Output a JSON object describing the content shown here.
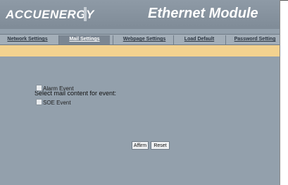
{
  "header": {
    "logo_text": "ACCUENERGY",
    "title": "Ethernet Module"
  },
  "nav": {
    "items": [
      {
        "label": "Network Settings",
        "active": false
      },
      {
        "label": "Mail Settings",
        "active": true
      },
      {
        "label": "Webpage Settings",
        "active": false
      },
      {
        "label": "Load Default",
        "active": false
      },
      {
        "label": "Password Setting",
        "active": false
      }
    ]
  },
  "form": {
    "heading": "Select mail content for event:",
    "options": [
      {
        "label": "Alarm Event",
        "checked": false
      },
      {
        "label": "SOE Event",
        "checked": false
      }
    ],
    "affirm_label": "Affirm",
    "reset_label": "Reset"
  },
  "colors": {
    "page_bg": "#93a0ac",
    "banner": "#f3d28f",
    "active_tab": "#7b8692"
  }
}
